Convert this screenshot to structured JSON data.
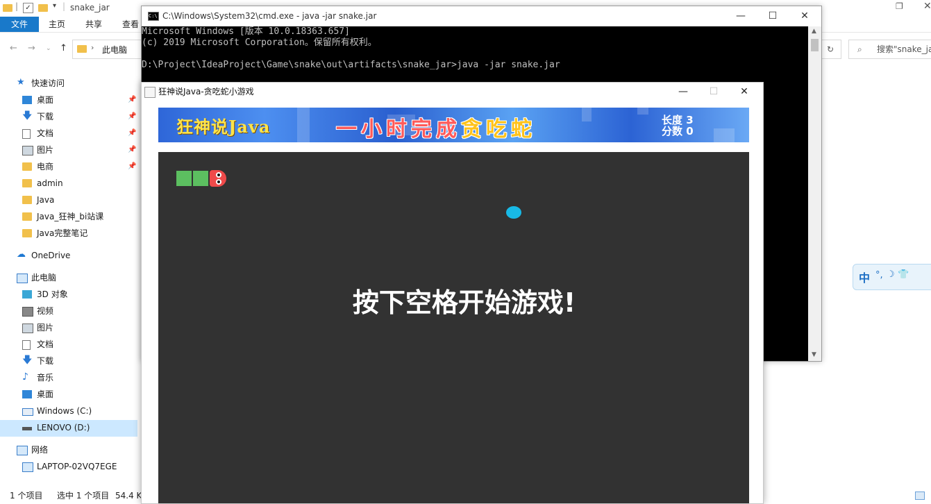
{
  "explorer": {
    "title": "snake_jar",
    "ribbon_tabs": [
      "文件",
      "主页",
      "共享",
      "查看"
    ],
    "address_crumb": "此电脑",
    "search_placeholder": "搜索\"snake_jar",
    "nav": {
      "quick_access": "快速访问",
      "quick_items": [
        "桌面",
        "下载",
        "文档",
        "图片",
        "电商",
        "admin",
        "Java",
        "Java_狂神_bi站课",
        "Java完整笔记"
      ],
      "onedrive": "OneDrive",
      "this_pc": "此电脑",
      "pc_items": [
        "3D 对象",
        "视频",
        "图片",
        "文档",
        "下载",
        "音乐",
        "桌面",
        "Windows (C:)",
        "LENOVO (D:)"
      ],
      "network": "网络",
      "network_items": [
        "LAPTOP-02VQ7EGE"
      ]
    },
    "status": {
      "items_count": "1 个项目",
      "selected": "选中 1 个项目",
      "size": "54.4 K"
    },
    "ime": "中"
  },
  "cmd": {
    "title": "C:\\Windows\\System32\\cmd.exe - java  -jar snake.jar",
    "lines": [
      "Microsoft Windows [版本 10.0.18363.657]",
      "(c) 2019 Microsoft Corporation。保留所有权利。",
      "",
      "D:\\Project\\IdeaProject\\Game\\snake\\out\\artifacts\\snake_jar>java -jar snake.jar"
    ]
  },
  "game": {
    "title": "狂神说Java-贪吃蛇小游戏",
    "banner_left": "狂神说Java",
    "banner_main_a": "一小时完成",
    "banner_main_b": "贪吃蛇",
    "length_label": "长度 3",
    "score_label": "分数 0",
    "prompt": "按下空格开始游戏!",
    "colors": {
      "board": "#323232",
      "snake_body": "#5cbf60",
      "snake_head": "#ef4a4a",
      "food": "#18b9e6"
    }
  }
}
